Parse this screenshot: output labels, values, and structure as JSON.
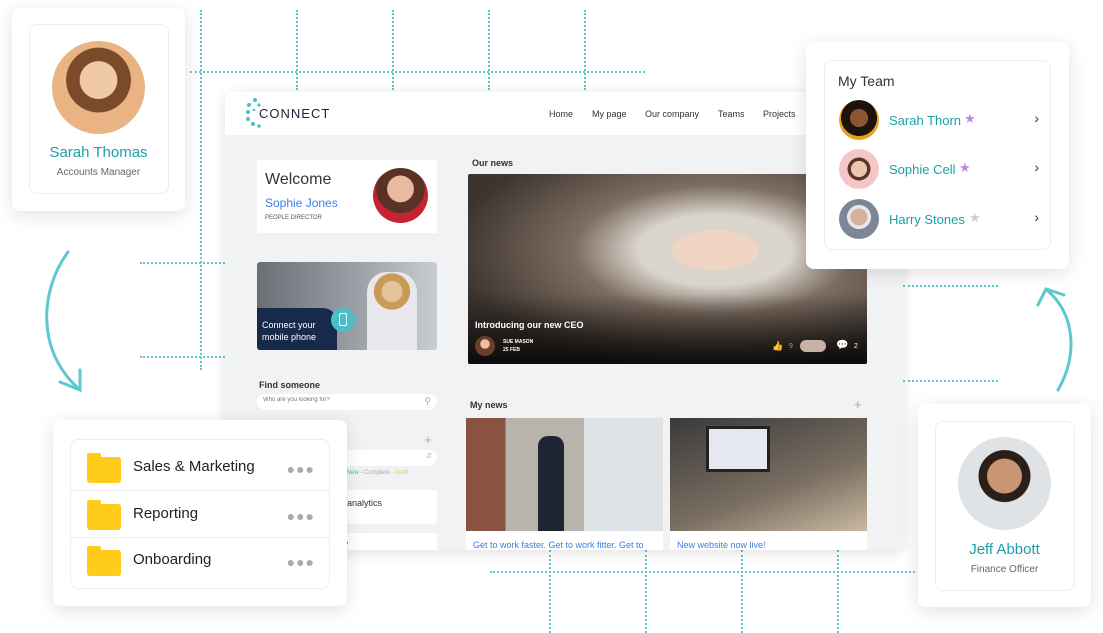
{
  "app": {
    "logo": "CONNECT",
    "nav": [
      "Home",
      "My page",
      "Our company",
      "Teams",
      "Projects"
    ]
  },
  "welcome": {
    "title": "Welcome",
    "name": "Sophie Jones",
    "role": "PEOPLE DIRECTOR"
  },
  "promo": {
    "text_line1": "Connect your",
    "text_line2": "mobile phone",
    "icon": "mobile-phone-icon"
  },
  "our_news": {
    "heading": "Our news",
    "headline": "Introducing our new CEO",
    "author": "SUE MASON",
    "date": "25 FEB",
    "likes": "9",
    "comments": "2"
  },
  "find": {
    "heading": "Find someone",
    "placeholder": "Who are you looking for?"
  },
  "tasks": {
    "status_new": "New",
    "status_complete": "Complete",
    "status_draft": "Draft",
    "items": [
      "analytics",
      "licy"
    ]
  },
  "my_news": {
    "heading": "My news",
    "items": [
      "Get to work faster. Get to work fitter. Get to",
      "New website now live!"
    ]
  },
  "profile_left": {
    "name": "Sarah Thomas",
    "role": "Accounts Manager"
  },
  "profile_right": {
    "name": "Jeff Abbott",
    "role": "Finance Officer"
  },
  "team": {
    "title": "My Team",
    "members": [
      {
        "name": "Sarah Thorn",
        "star": "#b98be0"
      },
      {
        "name": "Sophie Cell",
        "star": "#b98be0"
      },
      {
        "name": "Harry Stones",
        "star": "#cccccc"
      }
    ]
  },
  "folders": [
    "Sales & Marketing",
    "Reporting",
    "Onboarding"
  ],
  "colors": {
    "accent": "#1aa0a8",
    "folder": "#ffcc1a",
    "link": "#3b7fe0"
  }
}
